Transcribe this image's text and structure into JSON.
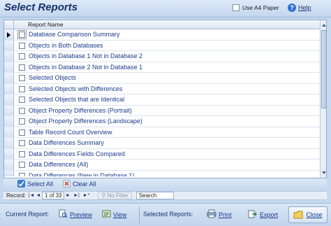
{
  "header": {
    "title": "Select Reports",
    "a4_label": "Use A4 Paper",
    "help_label": "Help",
    "help_icon": "?"
  },
  "grid": {
    "column_header": "Report Name",
    "rows": [
      {
        "label": "Database Comparison Summary",
        "checked": false,
        "current": true
      },
      {
        "label": "Objects in Both Databases",
        "checked": false
      },
      {
        "label": "Objects in Database 1 Not in Database 2",
        "checked": false
      },
      {
        "label": "Objects in Database 2 Not in Database 1",
        "checked": false
      },
      {
        "label": "Selected Objects",
        "checked": false
      },
      {
        "label": "Selected Objects with Differences",
        "checked": false
      },
      {
        "label": "Selected Objects that are Identical",
        "checked": false
      },
      {
        "label": "Object Property Differences (Portrait)",
        "checked": false
      },
      {
        "label": "Object Property Differences (Landscape)",
        "checked": false
      },
      {
        "label": "Table Record Count Overview",
        "checked": false
      },
      {
        "label": "Data Differences Summary",
        "checked": false
      },
      {
        "label": "Data Differences Fields Compared",
        "checked": false
      },
      {
        "label": "Data Differences (All)",
        "checked": false
      },
      {
        "label": "Data Differences (New in Database 1)",
        "checked": false
      }
    ]
  },
  "selection": {
    "select_all": "Select All",
    "clear_all": "Clear All"
  },
  "record_nav": {
    "record_label": "Record:",
    "first": "|◄",
    "prev": "◄",
    "position": "1 of 33",
    "next": "►",
    "last": "►|",
    "new": "►*",
    "no_filter": "No Filter",
    "search": "Search"
  },
  "footer": {
    "current_report_label": "Current Report:",
    "preview_label": "Preview",
    "view_label": "View",
    "selected_reports_label": "Selected Reports:",
    "print_label": "Print",
    "export_label": "Export",
    "close_label": "Close"
  },
  "colors": {
    "accent": "#17326b",
    "link": "#1a3b8c",
    "panel": "#c5d9ef"
  }
}
